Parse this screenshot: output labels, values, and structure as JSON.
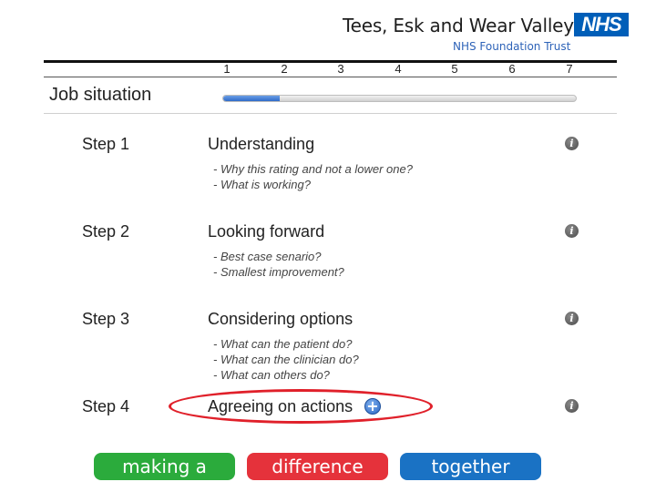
{
  "header": {
    "org_name": "Tees, Esk and Wear Valleys",
    "org_sub": "NHS Foundation Trust",
    "logo_text": "NHS"
  },
  "scale": {
    "ticks": [
      "1",
      "2",
      "3",
      "4",
      "5",
      "6",
      "7"
    ]
  },
  "section": {
    "title": "Job situation",
    "progress_fraction": 0.16
  },
  "steps": [
    {
      "label": "Step 1",
      "title": "Understanding",
      "prompts": [
        "- Why this rating and not a lower one?",
        "- What is working?"
      ],
      "info_icon": "info-icon"
    },
    {
      "label": "Step 2",
      "title": "Looking forward",
      "prompts": [
        "- Best case senario?",
        "- Smallest improvement?"
      ],
      "info_icon": "info-icon"
    },
    {
      "label": "Step 3",
      "title": "Considering options",
      "prompts": [
        "- What can the patient do?",
        "- What can the clinician do?",
        "- What can others do?"
      ],
      "info_icon": "info-icon"
    },
    {
      "label": "Step 4",
      "title": "Agreeing on actions",
      "prompts": [],
      "info_icon": "info-icon",
      "action_icon": "plus-icon"
    }
  ],
  "footer": {
    "buttons": [
      {
        "label": "making a",
        "color": "#2bab3c"
      },
      {
        "label": "difference",
        "color": "#e5323b"
      },
      {
        "label": "together",
        "color": "#1a72c4"
      }
    ]
  },
  "colors": {
    "nhs_blue": "#005eb8",
    "progress_blue": "#2f6bc9",
    "highlight_red": "#e0202a"
  }
}
